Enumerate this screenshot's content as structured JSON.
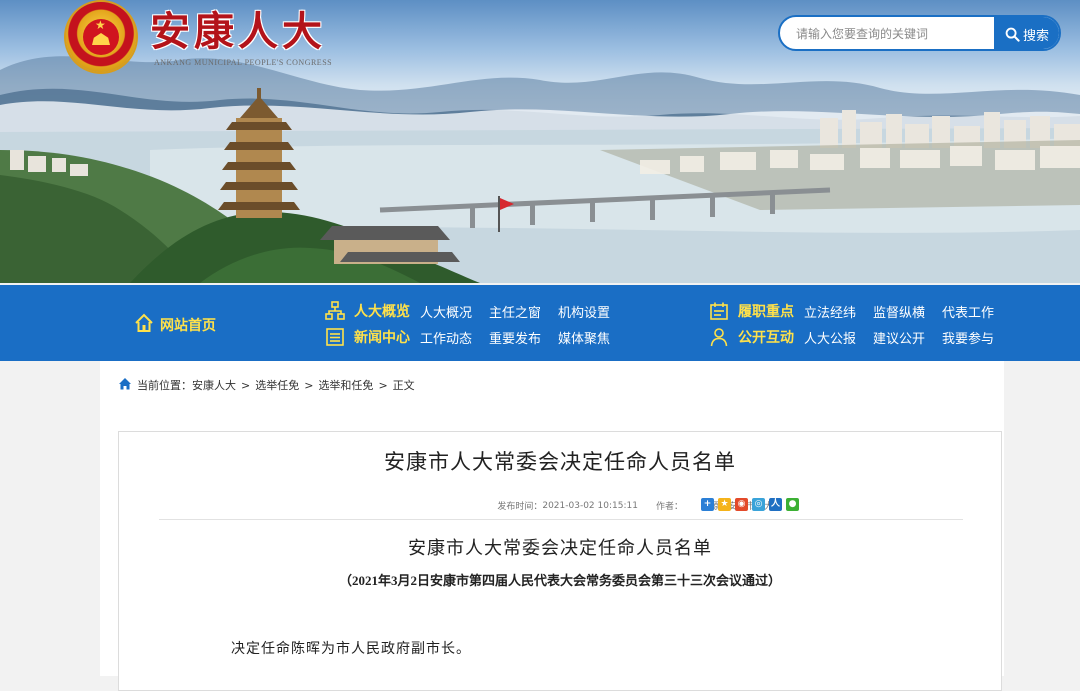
{
  "header": {
    "site_title": "安康人大",
    "site_subtitle": "ANKANG MUNICIPAL PEOPLE'S CONGRESS",
    "search": {
      "placeholder": "请输入您要查询的关键词",
      "button_label": "搜索"
    }
  },
  "nav": {
    "home_label": "网站首页",
    "groups": [
      {
        "title": "人大概览",
        "icon": "org-chart-icon",
        "links": [
          "人大概况",
          "主任之窗",
          "机构设置"
        ]
      },
      {
        "title": "新闻中心",
        "icon": "list-icon",
        "links": [
          "工作动态",
          "重要发布",
          "媒体聚焦"
        ]
      },
      {
        "title": "履职重点",
        "icon": "calendar-icon",
        "links": [
          "立法经纬",
          "监督纵横",
          "代表工作"
        ]
      },
      {
        "title": "公开互动",
        "icon": "person-icon",
        "links": [
          "人大公报",
          "建议公开",
          "我要参与"
        ]
      }
    ],
    "colors": {
      "background": "#1a6ec5",
      "highlight": "#ffe14a"
    }
  },
  "breadcrumb": {
    "prefix": "当前位置：",
    "items": [
      "安康人大",
      "选举任免",
      "选举和任免",
      "正文"
    ],
    "separator": ">"
  },
  "article": {
    "title": "安康市人大常委会决定任命人员名单",
    "meta": {
      "published_label": "发布时间：",
      "published_value": "2021-03-02 10:15:11",
      "author_label": "作者：",
      "author_value": "",
      "source_label": "来源：",
      "source_value": "安康市人大"
    },
    "share_icons": [
      "share-plus-icon",
      "qzone-icon",
      "weibo-icon",
      "tencent-weibo-icon",
      "renren-icon",
      "wechat-icon"
    ],
    "doc_title": "安康市人大常委会决定任命人员名单",
    "doc_subtitle": "（2021年3月2日安康市第四届人民代表大会常务委员会第三十三次会议通过）",
    "body": "决定任命陈晖为市人民政府副市长。"
  }
}
